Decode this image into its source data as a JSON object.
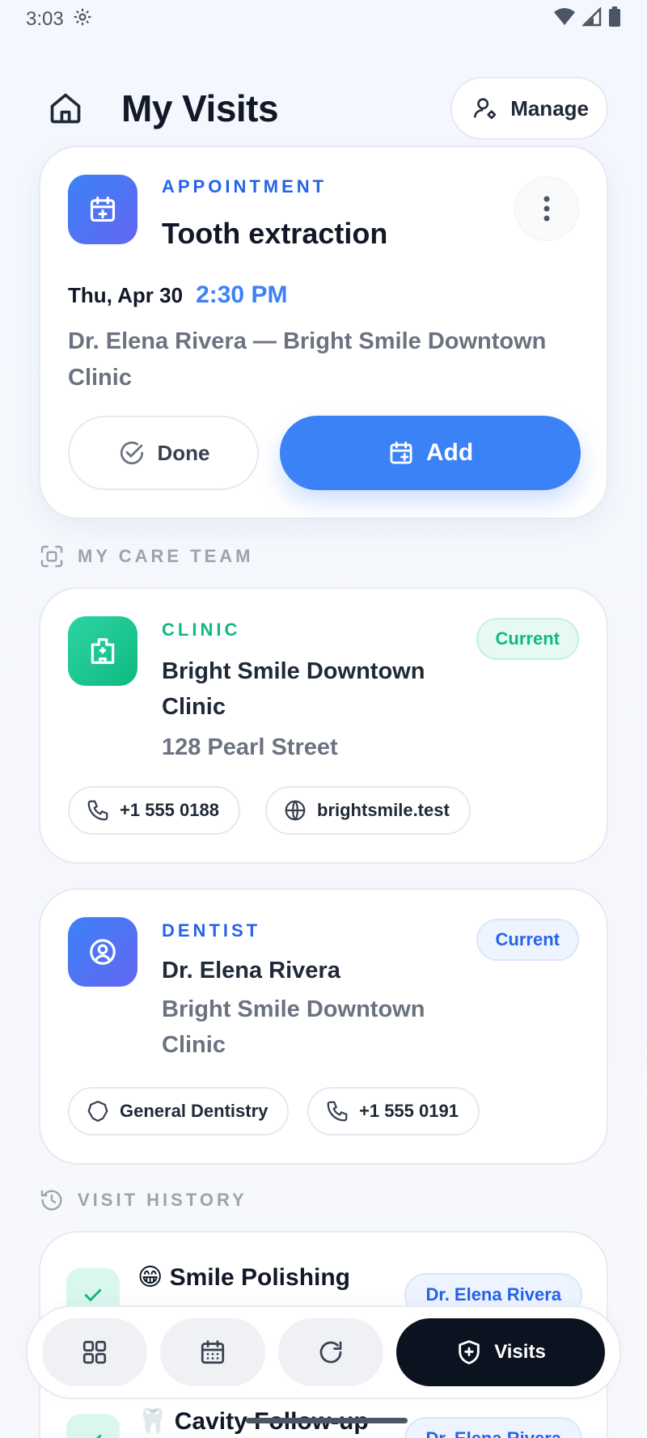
{
  "status_bar": {
    "time": "3:03"
  },
  "header": {
    "title": "My Visits",
    "manage_label": "Manage"
  },
  "appointment": {
    "eyebrow": "APPOINTMENT",
    "title": "Tooth extraction",
    "date": "Thu, Apr 30",
    "time": "2:30 PM",
    "subtitle": "Dr. Elena Rivera — Bright Smile Downtown Clinic",
    "done_label": "Done",
    "add_label": "Add"
  },
  "care_team": {
    "section_label": "MY CARE TEAM",
    "clinic": {
      "eyebrow": "CLINIC",
      "name": "Bright Smile Downtown Clinic",
      "address": "128 Pearl Street",
      "badge": "Current",
      "phone": "+1 555 0188",
      "website": "brightsmile.test"
    },
    "dentist": {
      "eyebrow": "DENTIST",
      "name": "Dr. Elena Rivera",
      "clinic": "Bright Smile Downtown Clinic",
      "badge": "Current",
      "specialty": "General Dentistry",
      "phone": "+1 555 0191"
    }
  },
  "history": {
    "section_label": "VISIT HISTORY",
    "items": [
      {
        "emoji": "😁",
        "title": "Smile Polishing",
        "doctor": "Dr. Elena Rivera"
      },
      {
        "emoji": "🦷",
        "title": "Cavity Follow-up",
        "doctor": "Dr. Elena Rivera"
      }
    ]
  },
  "bottom_nav": {
    "active_label": "Visits"
  },
  "colors": {
    "accent": "#3b82f6",
    "success": "#10b981",
    "dark": "#0b1220"
  }
}
